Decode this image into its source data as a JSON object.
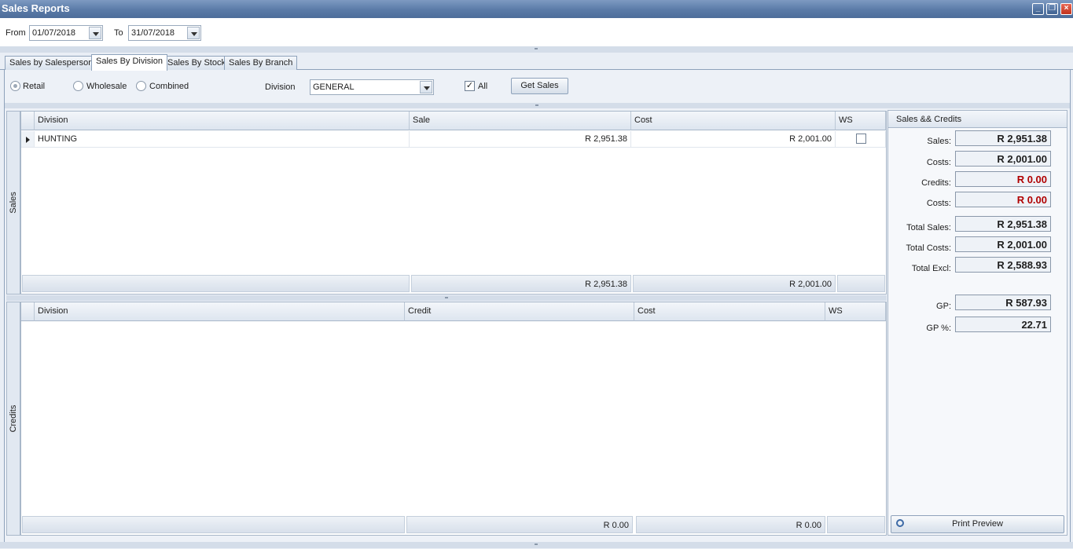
{
  "window": {
    "title": "Sales Reports"
  },
  "dates": {
    "from_label": "From",
    "from_value": "01/07/2018",
    "to_label": "To",
    "to_value": "31/07/2018"
  },
  "tabs": [
    "Sales by Salesperson",
    "Sales By Division",
    "Sales By Stock",
    "Sales By Branch"
  ],
  "filters": {
    "retail": "Retail",
    "wholesale": "Wholesale",
    "combined": "Combined",
    "division_label": "Division",
    "division_value": "GENERAL",
    "all_label": "All",
    "all_checked": "✓",
    "get_sales": "Get Sales"
  },
  "sales_grid": {
    "side_label": "Sales",
    "headers": [
      "Division",
      "Sale",
      "Cost",
      "WS"
    ],
    "rows": [
      {
        "division": "HUNTING",
        "sale": "R 2,951.38",
        "cost": "R 2,001.00"
      }
    ],
    "footer": {
      "sale": "R 2,951.38",
      "cost": "R 2,001.00"
    }
  },
  "credits_grid": {
    "side_label": "Credits",
    "headers": [
      "Division",
      "Credit",
      "Cost",
      "WS"
    ],
    "footer": {
      "credit": "R 0.00",
      "cost": "R 0.00"
    }
  },
  "summary": {
    "title": "Sales && Credits",
    "sales_label": "Sales:",
    "sales": "R 2,951.38",
    "costs_label": "Costs:",
    "costs": "R 2,001.00",
    "credits_label": "Credits:",
    "credits": "R 0.00",
    "credit_costs_label": "Costs:",
    "credit_costs": "R 0.00",
    "total_sales_label": "Total Sales:",
    "total_sales": "R 2,951.38",
    "total_costs_label": "Total Costs:",
    "total_costs": "R 2,001.00",
    "total_excl_label": "Total Excl:",
    "total_excl": "R 2,588.93",
    "gp_label": "GP:",
    "gp": "R 587.93",
    "gp_pct_label": "GP %:",
    "gp_pct": "22.71",
    "print_preview": "Print Preview"
  }
}
